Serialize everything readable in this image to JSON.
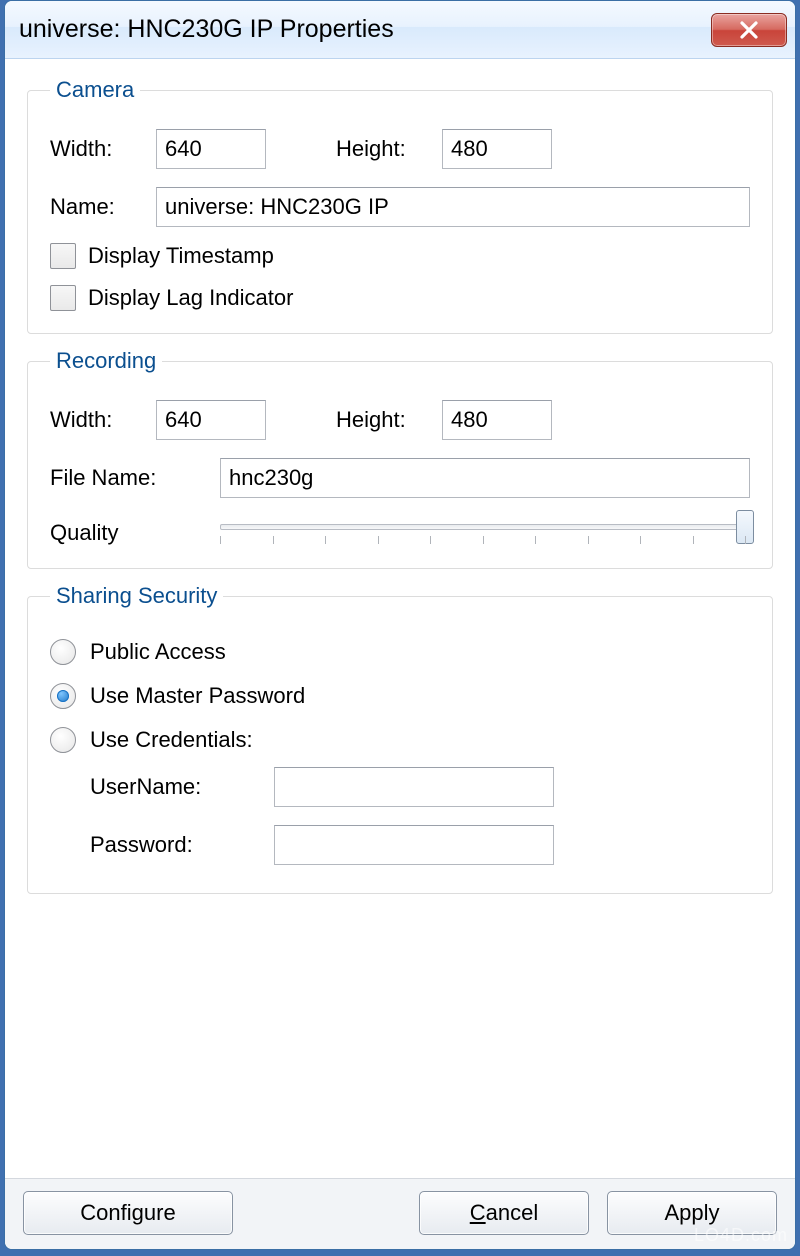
{
  "window": {
    "title": "universe: HNC230G IP Properties"
  },
  "camera": {
    "legend": "Camera",
    "width_label": "Width:",
    "width_value": "640",
    "height_label": "Height:",
    "height_value": "480",
    "name_label": "Name:",
    "name_value": "universe: HNC230G IP",
    "display_timestamp_label": "Display Timestamp",
    "display_timestamp_checked": false,
    "display_lag_label": "Display Lag Indicator",
    "display_lag_checked": false
  },
  "recording": {
    "legend": "Recording",
    "width_label": "Width:",
    "width_value": "640",
    "height_label": "Height:",
    "height_value": "480",
    "filename_label": "File Name:",
    "filename_value": "hnc230g",
    "quality_label": "Quality",
    "quality_percent": 100
  },
  "security": {
    "legend": "Sharing Security",
    "public_label": "Public Access",
    "master_label": "Use Master Password",
    "cred_label": "Use Credentials:",
    "selected": "master",
    "username_label": "UserName:",
    "username_value": "",
    "password_label": "Password:",
    "password_value": ""
  },
  "buttons": {
    "configure": "Configure",
    "cancel_pre": "",
    "cancel_u": "C",
    "cancel_post": "ancel",
    "apply": "Apply"
  },
  "watermark": "LO4D.com"
}
